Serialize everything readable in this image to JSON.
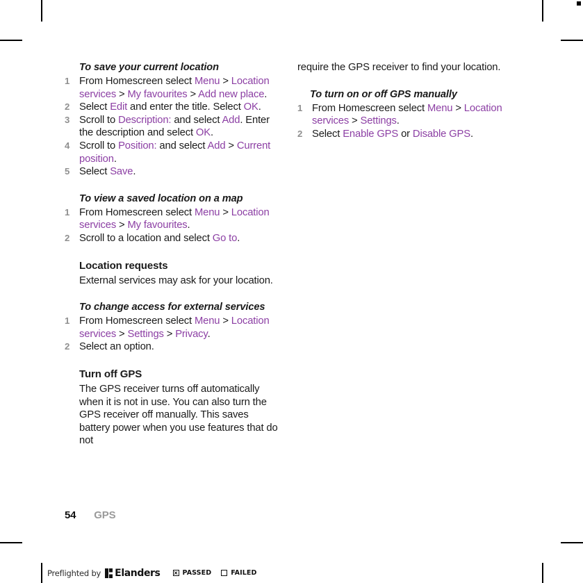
{
  "document": {
    "folio": "54",
    "running_head": "GPS"
  },
  "left_column": {
    "section_1": {
      "heading": "To save your current location",
      "steps": [
        {
          "num": "1",
          "parts": [
            {
              "text": "From Homescreen select ",
              "highlight": false
            },
            {
              "text": "Menu",
              "highlight": true
            },
            {
              "text": " > ",
              "highlight": false
            },
            {
              "text": "Location services",
              "highlight": true
            },
            {
              "text": " > ",
              "highlight": false
            },
            {
              "text": "My favourites",
              "highlight": true
            },
            {
              "text": " > ",
              "highlight": false
            },
            {
              "text": "Add new place",
              "highlight": true
            },
            {
              "text": ".",
              "highlight": false
            }
          ]
        },
        {
          "num": "2",
          "parts": [
            {
              "text": "Select ",
              "highlight": false
            },
            {
              "text": "Edit",
              "highlight": true
            },
            {
              "text": " and enter the title. Select ",
              "highlight": false
            },
            {
              "text": "OK",
              "highlight": true
            },
            {
              "text": ".",
              "highlight": false
            }
          ]
        },
        {
          "num": "3",
          "parts": [
            {
              "text": "Scroll to ",
              "highlight": false
            },
            {
              "text": "Description:",
              "highlight": true
            },
            {
              "text": " and select ",
              "highlight": false
            },
            {
              "text": "Add",
              "highlight": true
            },
            {
              "text": ". Enter the description and select ",
              "highlight": false
            },
            {
              "text": "OK",
              "highlight": true
            },
            {
              "text": ".",
              "highlight": false
            }
          ]
        },
        {
          "num": "4",
          "parts": [
            {
              "text": "Scroll to ",
              "highlight": false
            },
            {
              "text": "Position:",
              "highlight": true
            },
            {
              "text": " and select ",
              "highlight": false
            },
            {
              "text": "Add",
              "highlight": true
            },
            {
              "text": " > ",
              "highlight": false
            },
            {
              "text": "Current position",
              "highlight": true
            },
            {
              "text": ".",
              "highlight": false
            }
          ]
        },
        {
          "num": "5",
          "parts": [
            {
              "text": "Select ",
              "highlight": false
            },
            {
              "text": "Save",
              "highlight": true
            },
            {
              "text": ".",
              "highlight": false
            }
          ]
        }
      ]
    },
    "section_2": {
      "heading": "To view a saved location on a map",
      "steps": [
        {
          "num": "1",
          "parts": [
            {
              "text": "From Homescreen select ",
              "highlight": false
            },
            {
              "text": "Menu",
              "highlight": true
            },
            {
              "text": " > ",
              "highlight": false
            },
            {
              "text": "Location services",
              "highlight": true
            },
            {
              "text": " > ",
              "highlight": false
            },
            {
              "text": "My favourites",
              "highlight": true
            },
            {
              "text": ".",
              "highlight": false
            }
          ]
        },
        {
          "num": "2",
          "parts": [
            {
              "text": "Scroll to a location and select ",
              "highlight": false
            },
            {
              "text": "Go to",
              "highlight": true
            },
            {
              "text": ".",
              "highlight": false
            }
          ]
        }
      ]
    },
    "section_3": {
      "heading": "Location requests",
      "body": "External services may ask for your location."
    },
    "section_4": {
      "heading": "To change access for external services",
      "steps": [
        {
          "num": "1",
          "parts": [
            {
              "text": "From Homescreen select ",
              "highlight": false
            },
            {
              "text": "Menu",
              "highlight": true
            },
            {
              "text": " > ",
              "highlight": false
            },
            {
              "text": "Location services",
              "highlight": true
            },
            {
              "text": " > ",
              "highlight": false
            },
            {
              "text": "Settings",
              "highlight": true
            },
            {
              "text": " > ",
              "highlight": false
            },
            {
              "text": "Privacy",
              "highlight": true
            },
            {
              "text": ".",
              "highlight": false
            }
          ]
        },
        {
          "num": "2",
          "parts": [
            {
              "text": "Select an option.",
              "highlight": false
            }
          ]
        }
      ]
    },
    "section_5": {
      "heading": "Turn off GPS",
      "body": "The GPS receiver turns off automatically when it is not in use. You can also turn the GPS receiver off manually. This saves battery power when you use features that do not"
    }
  },
  "right_column": {
    "continuation": "require the GPS receiver to find your location.",
    "section_1": {
      "heading": "To turn on or off GPS manually",
      "steps": [
        {
          "num": "1",
          "parts": [
            {
              "text": "From Homescreen select ",
              "highlight": false
            },
            {
              "text": "Menu",
              "highlight": true
            },
            {
              "text": " > ",
              "highlight": false
            },
            {
              "text": "Location services",
              "highlight": true
            },
            {
              "text": " > ",
              "highlight": false
            },
            {
              "text": "Settings",
              "highlight": true
            },
            {
              "text": ".",
              "highlight": false
            }
          ]
        },
        {
          "num": "2",
          "parts": [
            {
              "text": "Select ",
              "highlight": false
            },
            {
              "text": "Enable GPS",
              "highlight": true
            },
            {
              "text": " or ",
              "highlight": false
            },
            {
              "text": "Disable GPS",
              "highlight": true
            },
            {
              "text": ".",
              "highlight": false
            }
          ]
        }
      ]
    }
  },
  "preflight": {
    "prefix": "Preflighted by",
    "brand": "Elanders",
    "passed_label": "PASSED",
    "failed_label": "FAILED",
    "passed_checked": true,
    "failed_checked": false
  },
  "colors": {
    "highlight": "#8c3fa4",
    "body_text": "#1a1a1a",
    "step_number": "#8f8f8f",
    "running_head": "#9a9a9a"
  }
}
